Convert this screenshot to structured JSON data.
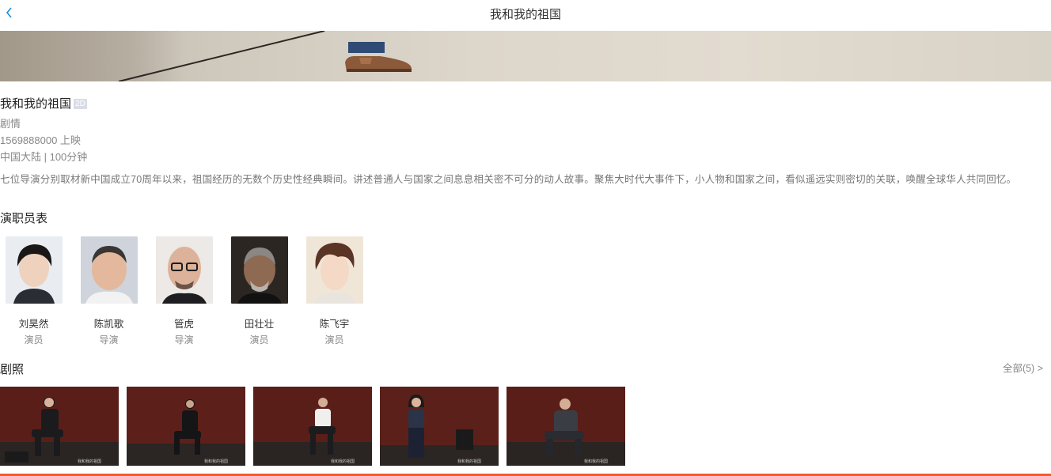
{
  "header": {
    "title": "我和我的祖国",
    "back_icon": "chevron-left-icon"
  },
  "movie": {
    "title": "我和我的祖国",
    "format": "2D",
    "genre": "剧情",
    "release": "1569888000 上映",
    "region_duration": "中国大陆 | 100分钟",
    "description": "七位导演分别取材新中国成立70周年以来，祖国经历的无数个历史性经典瞬间。讲述普通人与国家之间息息相关密不可分的动人故事。聚焦大时代大事件下，小人物和国家之间，看似遥远实则密切的关联，唤醒全球华人共同回忆。"
  },
  "cast": {
    "title": "演职员表",
    "members": [
      {
        "name": "刘昊然",
        "role": "演员"
      },
      {
        "name": "陈凯歌",
        "role": "导演"
      },
      {
        "name": "管虎",
        "role": "导演"
      },
      {
        "name": "田壮壮",
        "role": "演员"
      },
      {
        "name": "陈飞宇",
        "role": "演员"
      }
    ]
  },
  "stills": {
    "title": "剧照",
    "more_label": "全部(5) >"
  },
  "colors": {
    "accent": "#ef5b33",
    "link": "#1a8fd6"
  }
}
